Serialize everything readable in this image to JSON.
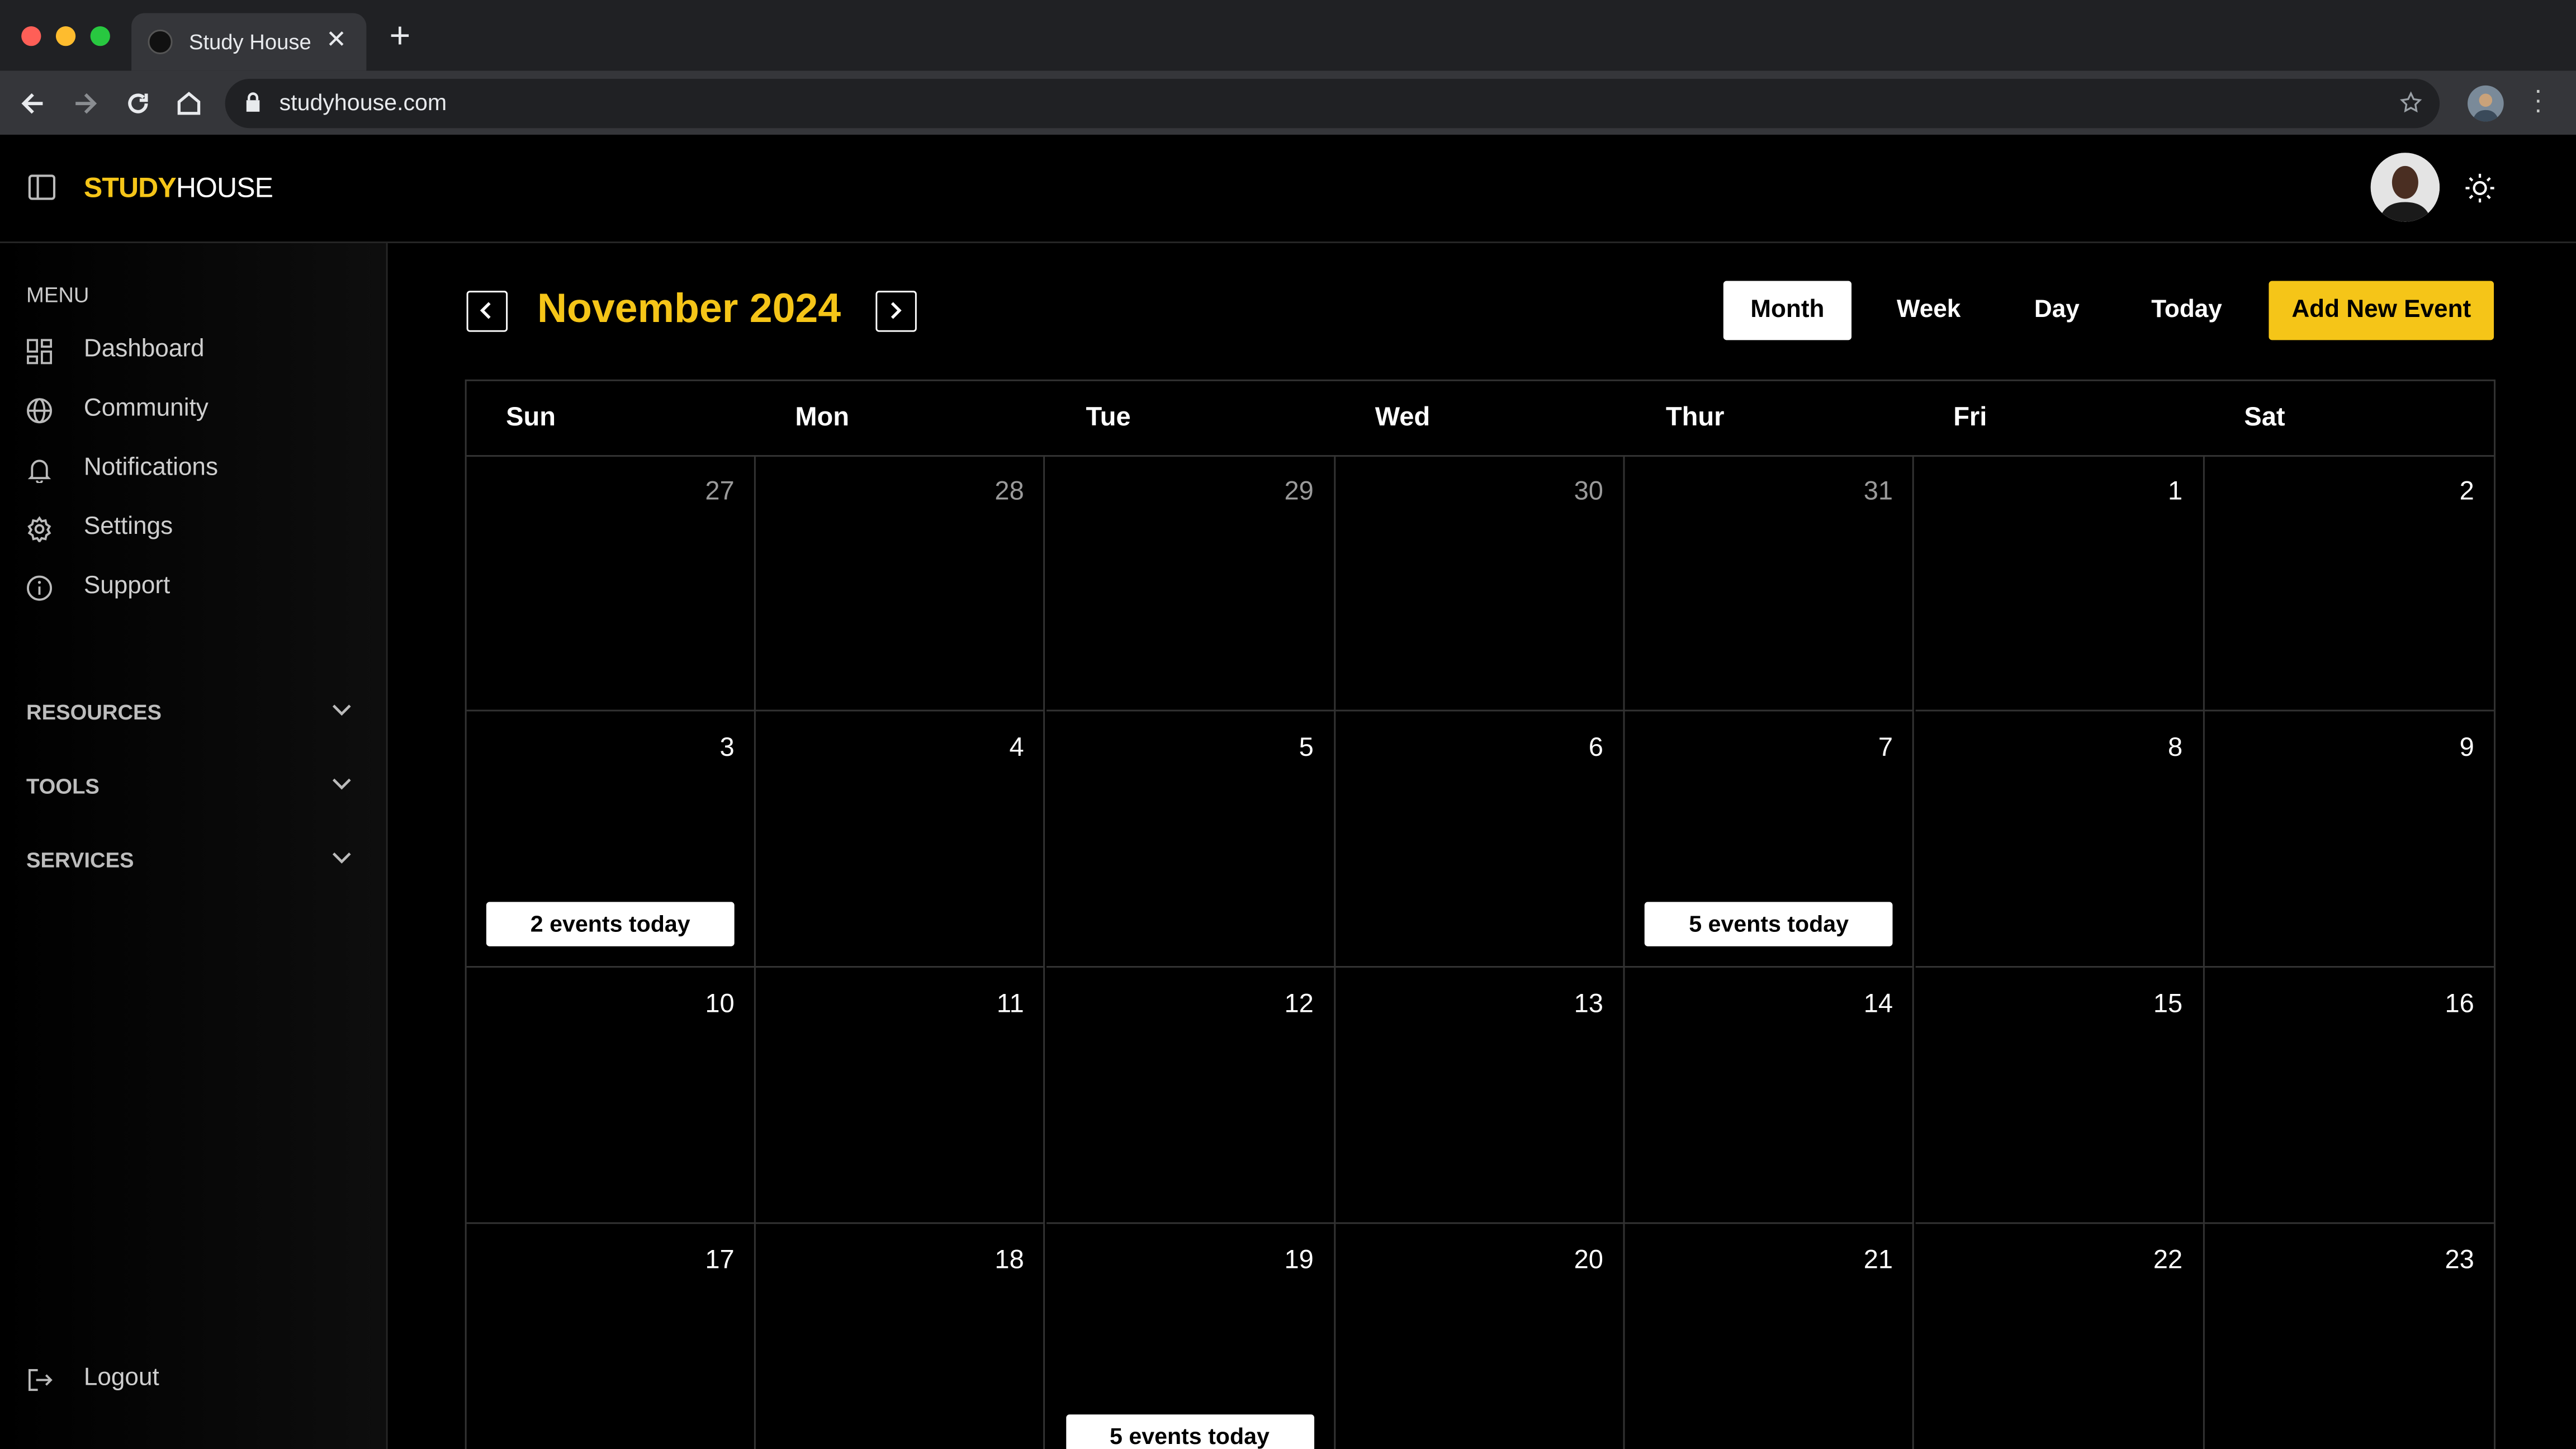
{
  "browser": {
    "tab_title": "Study House",
    "url": "studyhouse.com"
  },
  "brand": {
    "part1": "STUDY",
    "part2": "HOUSE",
    "accent_color": "#f5c518"
  },
  "sidebar": {
    "menu_label": "MENU",
    "items": [
      {
        "label": "Dashboard",
        "icon": "dashboard-icon"
      },
      {
        "label": "Community",
        "icon": "globe-icon"
      },
      {
        "label": "Notifications",
        "icon": "bell-icon"
      },
      {
        "label": "Settings",
        "icon": "gear-icon"
      },
      {
        "label": "Support",
        "icon": "info-icon"
      }
    ],
    "sections": [
      {
        "label": "RESOURCES"
      },
      {
        "label": "TOOLS"
      },
      {
        "label": "SERVICES"
      }
    ],
    "logout_label": "Logout"
  },
  "calendar": {
    "title": "November 2024",
    "views": [
      "Month",
      "Week",
      "Day",
      "Today"
    ],
    "active_view": "Month",
    "add_event_label": "Add New Event",
    "weekdays": [
      "Sun",
      "Mon",
      "Tue",
      "Wed",
      "Thur",
      "Fri",
      "Sat"
    ],
    "weeks": [
      [
        {
          "day": "27",
          "muted": true
        },
        {
          "day": "28",
          "muted": true
        },
        {
          "day": "29",
          "muted": true
        },
        {
          "day": "30",
          "muted": true
        },
        {
          "day": "31",
          "muted": true
        },
        {
          "day": "1"
        },
        {
          "day": "2"
        }
      ],
      [
        {
          "day": "3",
          "events": "2 events today"
        },
        {
          "day": "4"
        },
        {
          "day": "5"
        },
        {
          "day": "6"
        },
        {
          "day": "7",
          "events": "5 events today"
        },
        {
          "day": "8"
        },
        {
          "day": "9"
        }
      ],
      [
        {
          "day": "10"
        },
        {
          "day": "11"
        },
        {
          "day": "12"
        },
        {
          "day": "13"
        },
        {
          "day": "14"
        },
        {
          "day": "15"
        },
        {
          "day": "16"
        }
      ],
      [
        {
          "day": "17"
        },
        {
          "day": "18"
        },
        {
          "day": "19",
          "events": "5 events today"
        },
        {
          "day": "20"
        },
        {
          "day": "21"
        },
        {
          "day": "22"
        },
        {
          "day": "23"
        }
      ]
    ]
  }
}
